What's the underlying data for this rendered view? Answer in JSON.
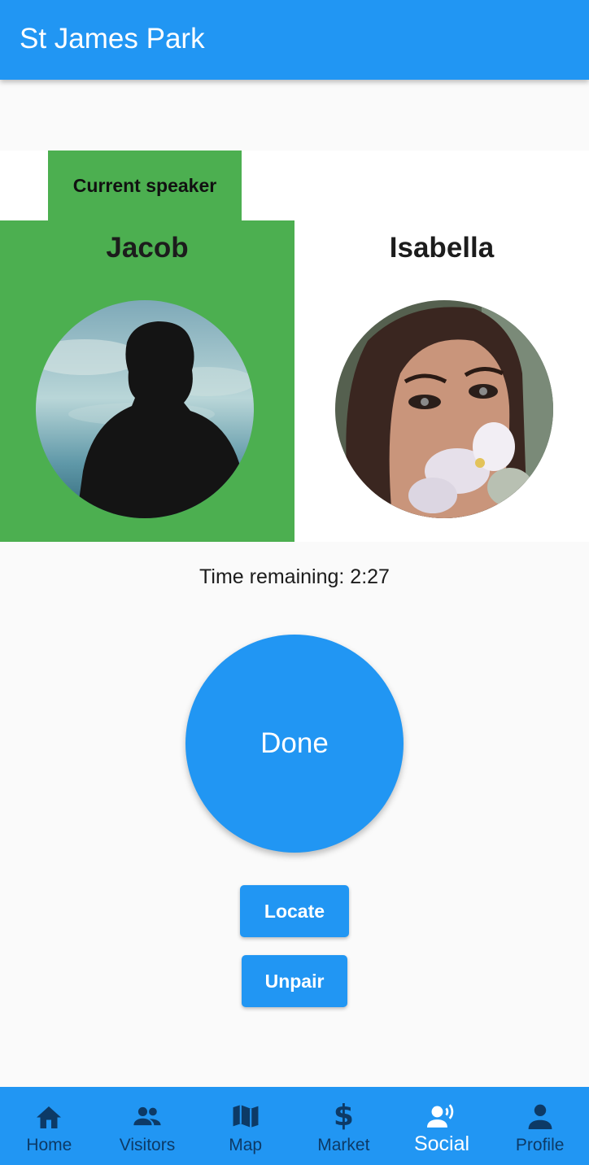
{
  "app": {
    "title": "St James Park"
  },
  "speakers": {
    "current_tag": "Current speaker",
    "left": {
      "name": "Jacob"
    },
    "right": {
      "name": "Isabella"
    }
  },
  "timer": {
    "text": "Time remaining: 2:27"
  },
  "actions": {
    "done_label": "Done",
    "locate_label": "Locate",
    "unpair_label": "Unpair"
  },
  "nav": {
    "items": [
      {
        "label": "Home",
        "icon": "home-icon"
      },
      {
        "label": "Visitors",
        "icon": "people-icon"
      },
      {
        "label": "Map",
        "icon": "map-icon"
      },
      {
        "label": "Market",
        "icon": "dollar-icon"
      },
      {
        "label": "Social",
        "icon": "social-speaker-icon",
        "active": true
      },
      {
        "label": "Profile",
        "icon": "person-icon"
      }
    ]
  },
  "colors": {
    "primary": "#2196f3",
    "speaker_highlight": "#4caf50",
    "nav_inactive": "#0d3a66"
  }
}
